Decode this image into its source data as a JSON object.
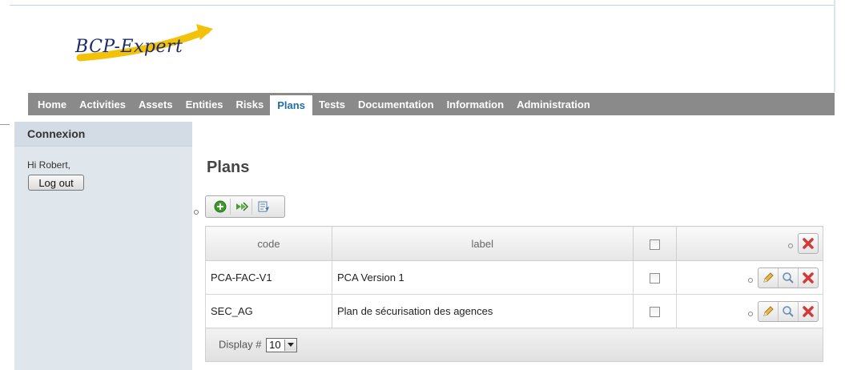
{
  "brand": {
    "logo_text": "BCP-Expert"
  },
  "nav": {
    "items": [
      {
        "label": "Home"
      },
      {
        "label": "Activities"
      },
      {
        "label": "Assets"
      },
      {
        "label": "Entities"
      },
      {
        "label": "Risks"
      },
      {
        "label": "Plans"
      },
      {
        "label": "Tests"
      },
      {
        "label": "Documentation"
      },
      {
        "label": "Information"
      },
      {
        "label": "Administration"
      }
    ],
    "active": "Plans"
  },
  "sidebar": {
    "title": "Connexion",
    "greeting": "Hi Robert,",
    "logout_label": "Log out"
  },
  "main": {
    "title": "Plans"
  },
  "toolbar": {
    "icons": [
      "add-icon",
      "export-icon",
      "edit-list-icon"
    ]
  },
  "table": {
    "headers": {
      "code": "code",
      "label": "label"
    },
    "rows": [
      {
        "code": "PCA-FAC-V1",
        "label": "PCA Version 1"
      },
      {
        "code": "SEC_AG",
        "label": "Plan de sécurisation des agences"
      }
    ],
    "footer": {
      "display_label": "Display #",
      "page_size": "10"
    }
  },
  "colors": {
    "nav_bg": "#8a8a8a",
    "nav_active_text": "#1f6fa8",
    "sidebar_bg": "#dfe6ec",
    "delete_red": "#d23a3a",
    "add_green": "#3a9a2a"
  }
}
